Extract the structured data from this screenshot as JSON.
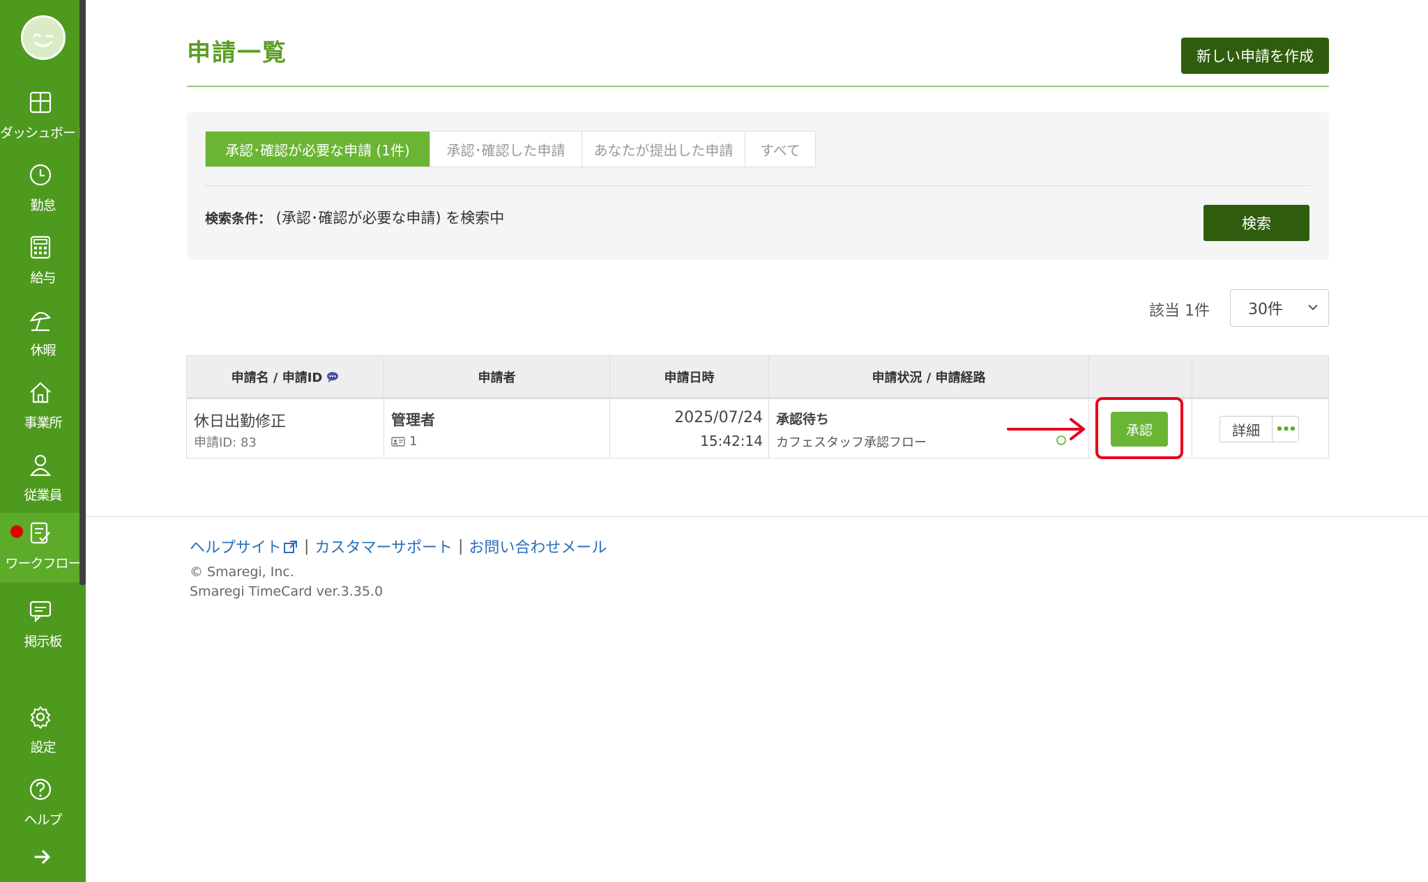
{
  "colors": {
    "sidebar": "#4e9a1f",
    "sidebar_active": "#5cab29",
    "title": "#5a9e25",
    "dark_button": "#2f5d0d",
    "active_tab": "#6ab534",
    "highlight": "#e8001c",
    "link": "#2a6fb8"
  },
  "sidebar": {
    "items": [
      {
        "label": "ダッシュボード",
        "icon": "dashboard-icon"
      },
      {
        "label": "勤怠",
        "icon": "clock-icon"
      },
      {
        "label": "給与",
        "icon": "calculator-icon"
      },
      {
        "label": "休暇",
        "icon": "umbrella-icon"
      },
      {
        "label": "事業所",
        "icon": "home-icon"
      },
      {
        "label": "従業員",
        "icon": "person-icon"
      },
      {
        "label": "ワークフロー",
        "icon": "workflow-icon",
        "active": true,
        "notification": true
      },
      {
        "label": "掲示板",
        "icon": "message-icon"
      },
      {
        "label": "設定",
        "icon": "gear-icon"
      },
      {
        "label": "ヘルプ",
        "icon": "help-icon"
      }
    ]
  },
  "header": {
    "title": "申請一覧",
    "create_label": "新しい申請を作成"
  },
  "filter": {
    "tabs": [
      {
        "label": "承認･確認が必要な申請 (1件)",
        "active": true
      },
      {
        "label": "承認･確認した申請",
        "active": false
      },
      {
        "label": "あなたが提出した申請",
        "active": false
      },
      {
        "label": "すべて",
        "active": false
      }
    ],
    "condition_label": "検索条件：",
    "condition_value": "(承認･確認が必要な申請) を検索中",
    "search_label": "検索"
  },
  "results": {
    "count_label": "該当 1件",
    "per_page": "30件"
  },
  "table": {
    "headers": [
      "申請名 / 申請ID",
      "申請者",
      "申請日時",
      "申請状況 / 申請経路",
      "",
      ""
    ],
    "rows": [
      {
        "name": "休日出勤修正",
        "id_label": "申請ID: 83",
        "applicant": "管理者",
        "applicant_count": "1",
        "date": "2025/07/24",
        "time": "15:42:14",
        "status": "承認待ち",
        "route": "カフェスタッフ承認フロー",
        "approve_label": "承認",
        "detail_label": "詳細",
        "more_label": "•••"
      }
    ]
  },
  "footer": {
    "links": [
      "ヘルプサイト",
      "カスタマーサポート",
      "お問い合わせメール"
    ],
    "separator": "|",
    "copyright": "© Smaregi, Inc.",
    "version": "Smaregi TimeCard ver.3.35.0"
  }
}
